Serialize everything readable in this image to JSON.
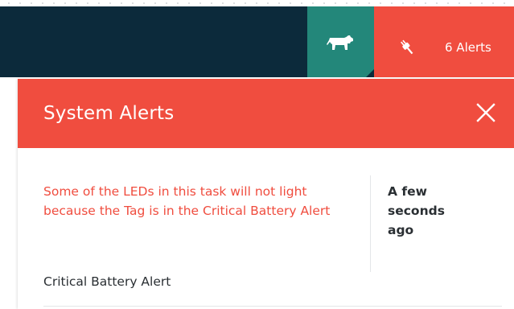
{
  "nav": {
    "cow_icon": "cow-icon",
    "alerts_icon": "plug-icon",
    "alerts_label": "6 Alerts"
  },
  "alerts_panel": {
    "title": "System Alerts",
    "close_icon": "close-icon",
    "alerts": [
      {
        "message": "Some of the LEDs in this task will not light because the Tag is in the Critical Battery Alert",
        "time": "A few seconds ago",
        "type": "Critical Battery Alert"
      }
    ]
  },
  "colors": {
    "nav_dark": "#0c2a3b",
    "cow_tab": "#23877a",
    "alert_red": "#f04d3f",
    "text_dark": "#2a2f33",
    "white": "#ffffff"
  }
}
